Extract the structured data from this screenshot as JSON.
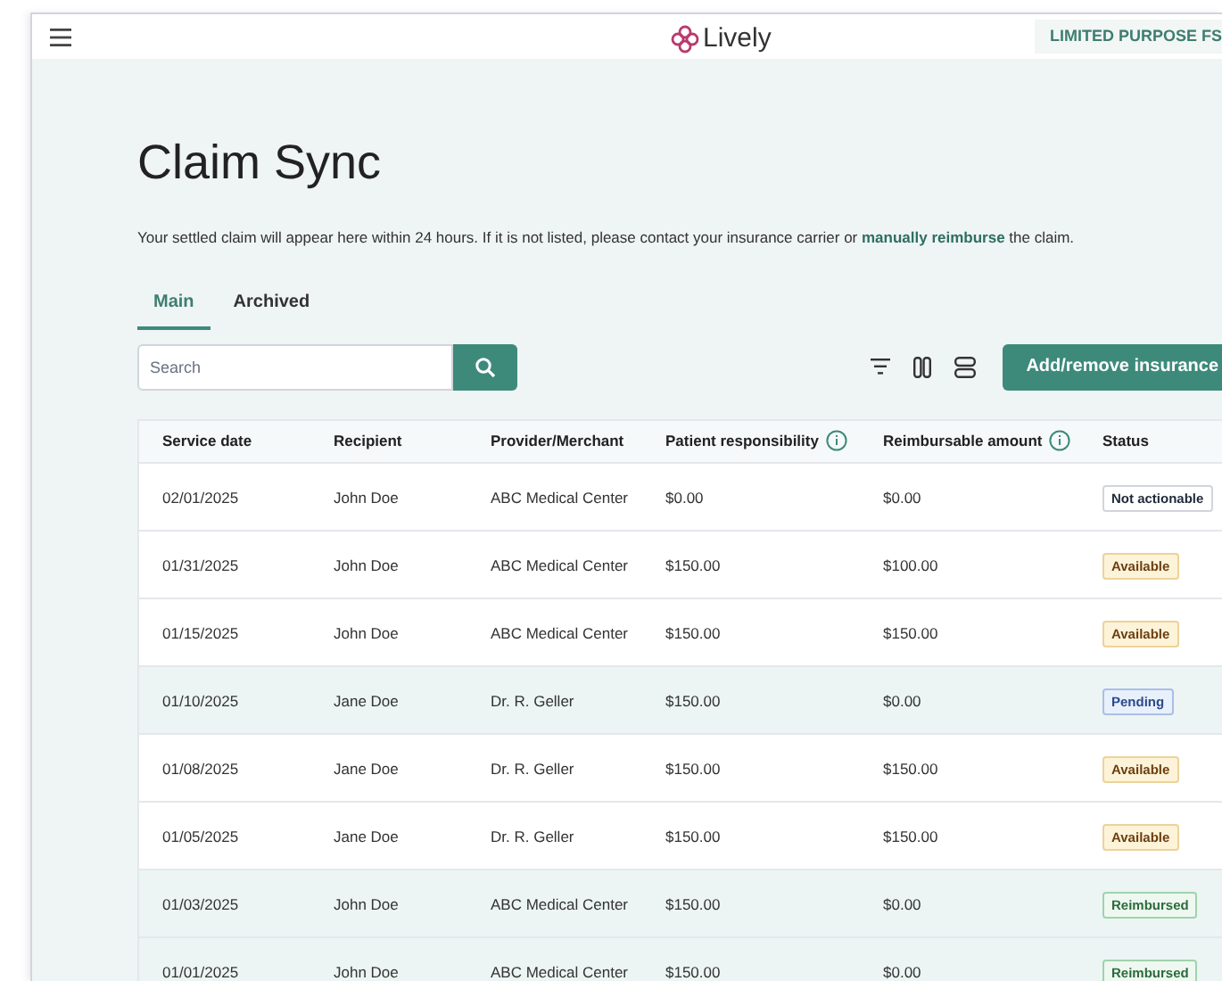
{
  "header": {
    "logo": "Lively",
    "badge": "LIMITED PURPOSE FS"
  },
  "title": "Claim Sync",
  "description": {
    "before": "Your settled claim will appear here within 24 hours. If it is not listed, please contact your insurance carrier or ",
    "link": "manually reimburse",
    "after": " the claim."
  },
  "tabs": [
    {
      "label": "Main",
      "selected": true
    },
    {
      "label": "Archived",
      "selected": false
    }
  ],
  "search": {
    "placeholder": "Search"
  },
  "add_button": "Add/remove insurance",
  "table": {
    "columns": [
      {
        "label": "Service date",
        "info": false
      },
      {
        "label": "Recipient",
        "info": false
      },
      {
        "label": "Provider/Merchant",
        "info": false
      },
      {
        "label": "Patient responsibility",
        "info": true
      },
      {
        "label": "Reimbursable amount",
        "info": true
      },
      {
        "label": "Status",
        "info": false
      }
    ],
    "rows": [
      {
        "cells": [
          "02/01/2025",
          "John Doe",
          "ABC Medical Center",
          "$0.00",
          "$0.00"
        ],
        "status": {
          "label": "Not actionable",
          "kind": "neutral"
        },
        "shaded": false
      },
      {
        "cells": [
          "01/31/2025",
          "John Doe",
          "ABC Medical Center",
          "$150.00",
          "$100.00"
        ],
        "status": {
          "label": "Available",
          "kind": "available"
        },
        "shaded": false
      },
      {
        "cells": [
          "01/15/2025",
          "John Doe",
          "ABC Medical Center",
          "$150.00",
          "$150.00"
        ],
        "status": {
          "label": "Available",
          "kind": "available"
        },
        "shaded": false
      },
      {
        "cells": [
          "01/10/2025",
          "Jane Doe",
          "Dr. R. Geller",
          "$150.00",
          "$0.00"
        ],
        "status": {
          "label": "Pending",
          "kind": "pending"
        },
        "shaded": true
      },
      {
        "cells": [
          "01/08/2025",
          "Jane Doe",
          "Dr. R. Geller",
          "$150.00",
          "$150.00"
        ],
        "status": {
          "label": "Available",
          "kind": "available"
        },
        "shaded": false
      },
      {
        "cells": [
          "01/05/2025",
          "Jane Doe",
          "Dr. R. Geller",
          "$150.00",
          "$150.00"
        ],
        "status": {
          "label": "Available",
          "kind": "available"
        },
        "shaded": false
      },
      {
        "cells": [
          "01/03/2025",
          "John Doe",
          "ABC Medical Center",
          "$150.00",
          "$0.00"
        ],
        "status": {
          "label": "Reimbursed",
          "kind": "reimbursed"
        },
        "shaded": true
      },
      {
        "cells": [
          "01/01/2025",
          "John Doe",
          "ABC Medical Center",
          "$150.00",
          "$0.00"
        ],
        "status": {
          "label": "Reimbursed",
          "kind": "reimbursed"
        },
        "shaded": true
      }
    ]
  }
}
